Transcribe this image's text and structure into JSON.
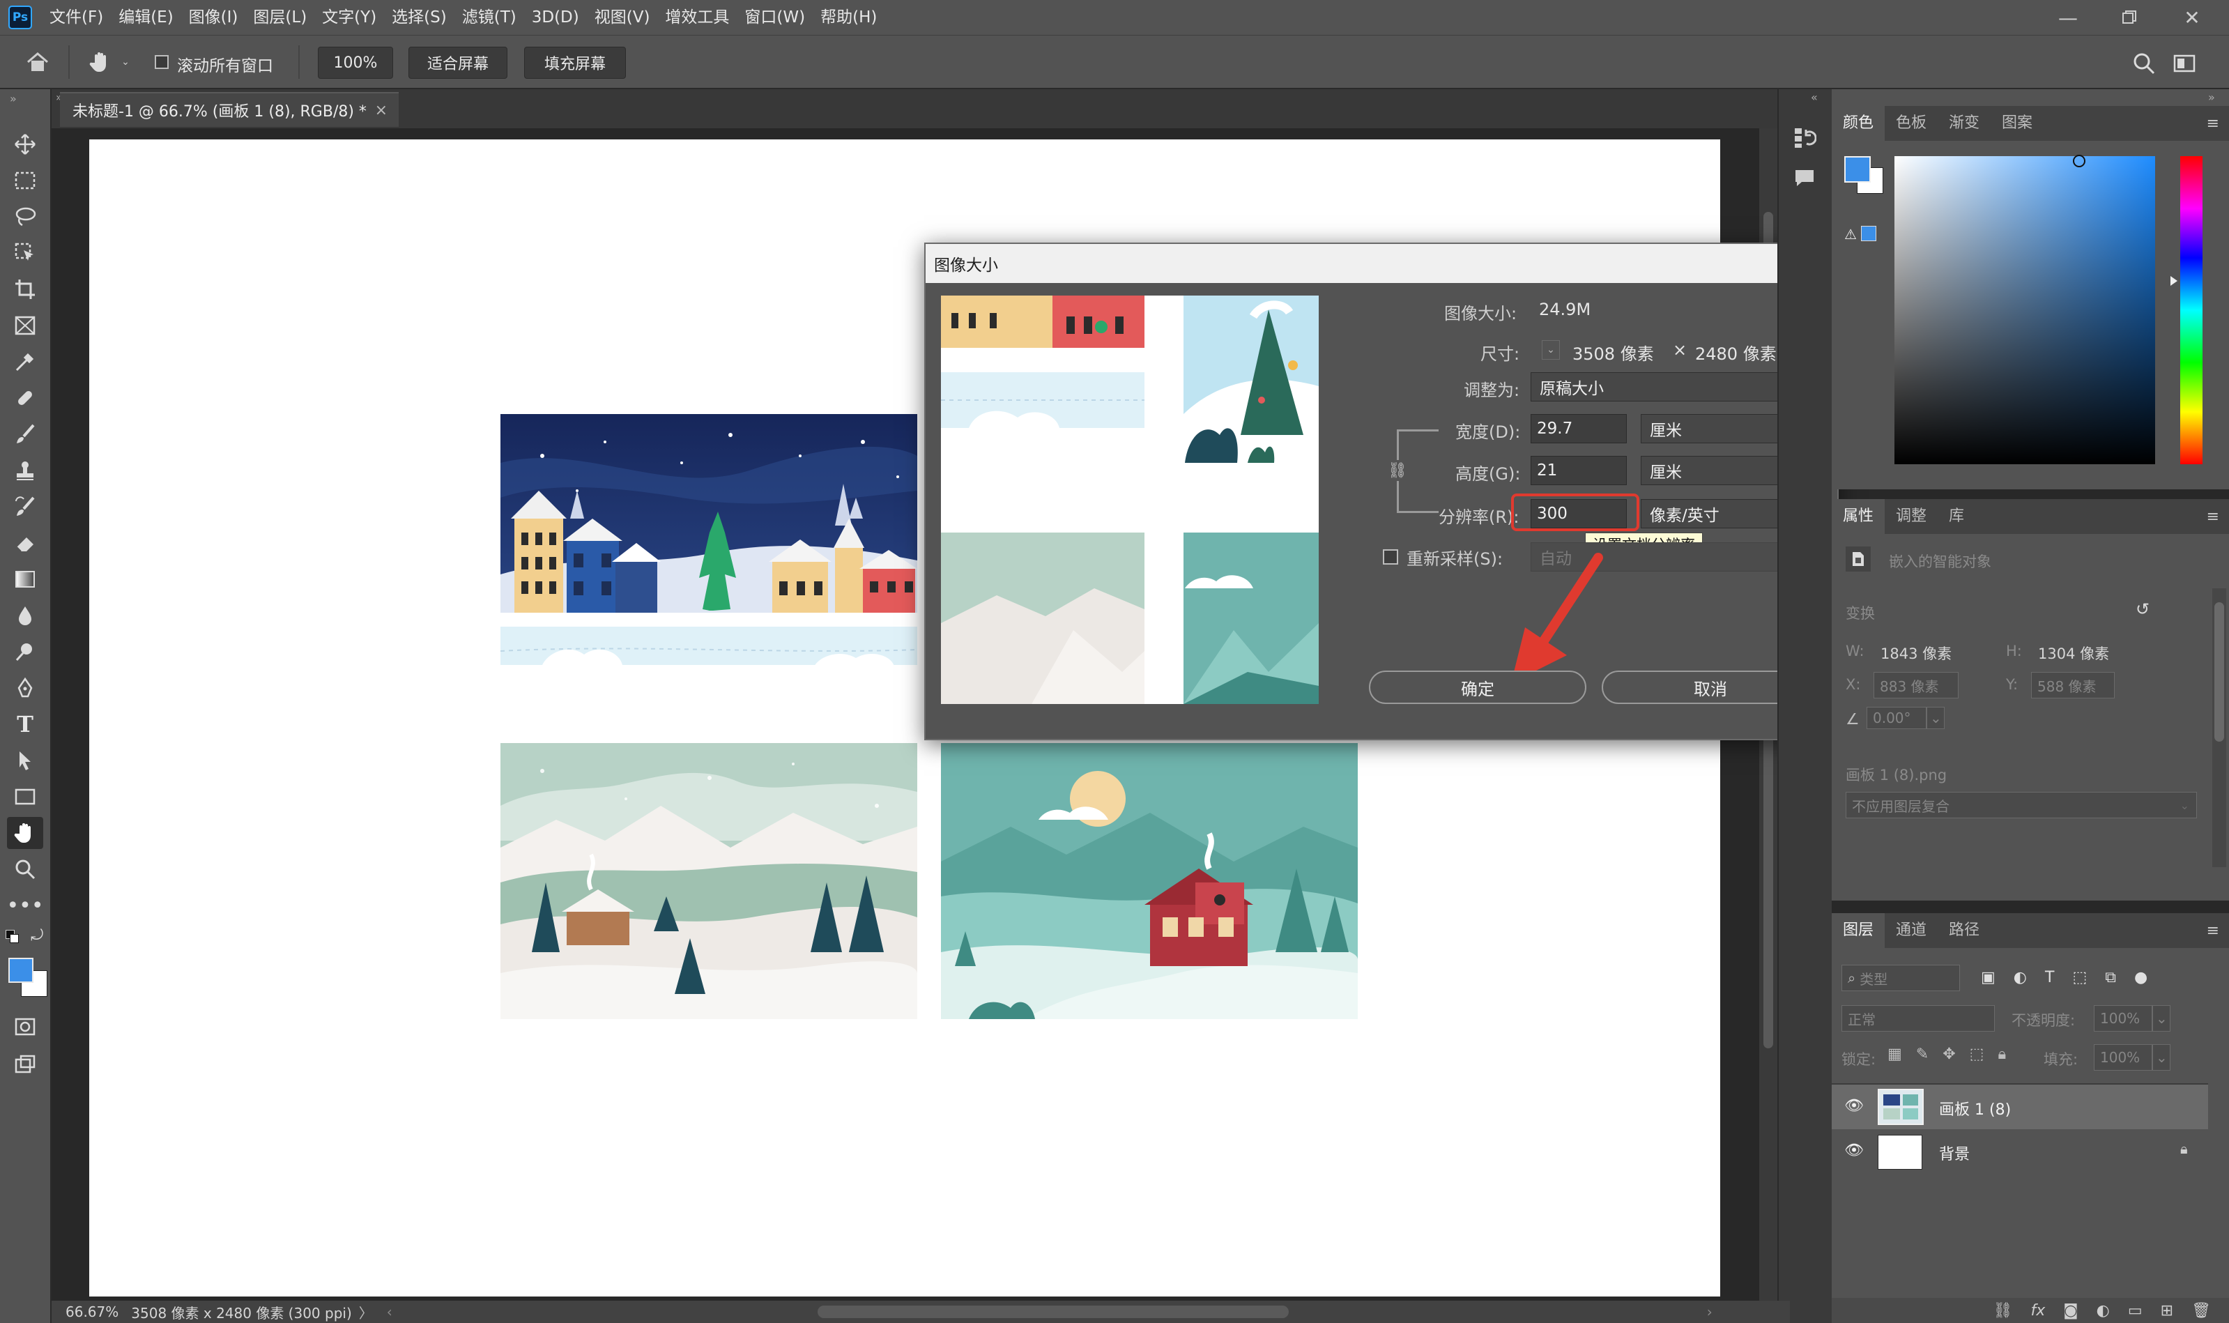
{
  "app": {
    "logo_text": "Ps",
    "menu": [
      "文件(F)",
      "编辑(E)",
      "图像(I)",
      "图层(L)",
      "文字(Y)",
      "选择(S)",
      "滤镜(T)",
      "3D(D)",
      "视图(V)",
      "增效工具",
      "窗口(W)",
      "帮助(H)"
    ]
  },
  "options_bar": {
    "scroll_all_label": "滚动所有窗口",
    "zoom_value": "100%",
    "fit_screen_label": "适合屏幕",
    "fill_screen_label": "填充屏幕"
  },
  "document": {
    "tab_title": "未标题-1 @ 66.7% (画板 1 (8), RGB/8) *",
    "tab_close": "×"
  },
  "status_bar": {
    "zoom": "66.67%",
    "doc_info": "3508 像素 x 2480 像素 (300 ppi)",
    "arrow": "〉"
  },
  "dialog": {
    "title": "图像大小",
    "close": "×",
    "image_size_label": "图像大小:",
    "image_size_value": "24.9M",
    "dimensions_label": "尺寸:",
    "dim_width": "3508 像素",
    "dim_times": "×",
    "dim_height": "2480 像素",
    "fit_to_label": "调整为:",
    "fit_to_value": "原稿大小",
    "width_label": "宽度(D):",
    "width_value": "29.7",
    "width_unit": "厘米",
    "height_label": "高度(G):",
    "height_value": "21",
    "height_unit": "厘米",
    "resolution_label": "分辨率(R):",
    "resolution_value": "300",
    "resolution_unit": "像素/英寸",
    "tooltip": "设置文档分辨率",
    "resample_label": "重新采样(S):",
    "resample_value": "自动",
    "ok_label": "确定",
    "cancel_label": "取消",
    "accent_red": "#e03a2f"
  },
  "color_panel": {
    "tabs": [
      "颜色",
      "色板",
      "渐变",
      "图案"
    ],
    "foreground": "#3b8fe8",
    "background": "#ffffff",
    "hue": "#1e8cff"
  },
  "properties_panel": {
    "tabs": [
      "属性",
      "调整",
      "库"
    ],
    "object_type": "嵌入的智能对象",
    "transform_label": "变换",
    "w_label": "W:",
    "w_value": "1843 像素",
    "h_label": "H:",
    "h_value": "1304 像素",
    "x_label": "X:",
    "x_value": "883 像素",
    "y_label": "Y:",
    "y_value": "588 像素",
    "angle_value": "0.00°",
    "file_name": "画板 1 (8).png",
    "comp_value": "不应用图层复合"
  },
  "layers_panel": {
    "tabs": [
      "图层",
      "通道",
      "路径"
    ],
    "filter_kind": "类型",
    "blend_mode": "正常",
    "opacity_label": "不透明度:",
    "opacity_value": "100%",
    "lock_label": "锁定:",
    "fill_label": "填充:",
    "fill_value": "100%",
    "layers": [
      {
        "name": "画板 1 (8)",
        "selected": true
      },
      {
        "name": "背景",
        "selected": false
      }
    ],
    "fx_label": "fx"
  }
}
